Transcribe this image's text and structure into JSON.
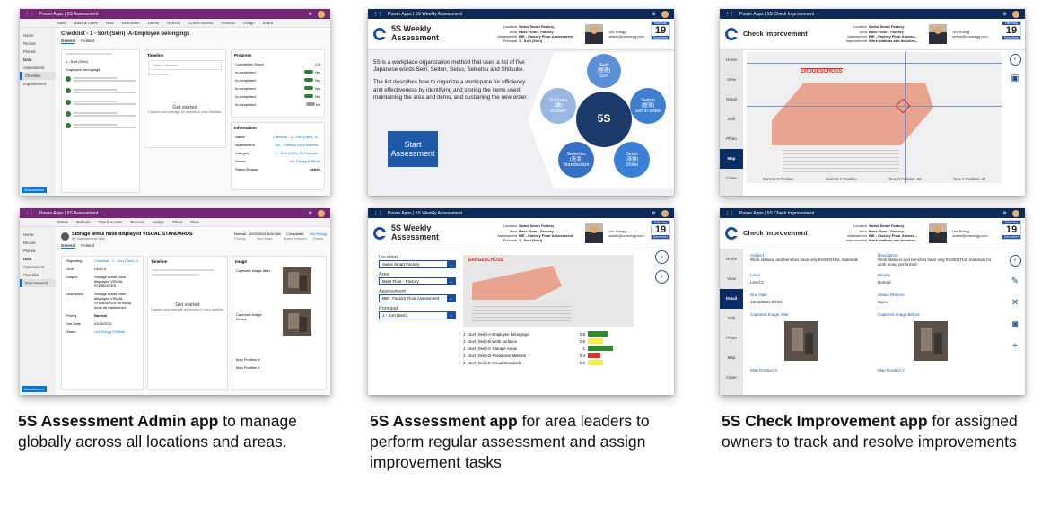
{
  "admin_app": {
    "app_bar": "Power Apps | 5S Assessment",
    "commands": [
      "Save",
      "Save & Close",
      "New",
      "Deactivate",
      "Delete",
      "Refresh",
      "Check Access",
      "Process",
      "Assign",
      "Share",
      "Flow"
    ],
    "nav": {
      "items": [
        "Home",
        "Recent",
        "Pinned"
      ],
      "section": "Data",
      "data_items": [
        "Assessment",
        "Checklist",
        "Improvement"
      ],
      "footer": "Assessment"
    },
    "screen1": {
      "title": "Checklist - 1 - Sort (Seiri) -A-Employee belongings",
      "subtitle": "5S Checklist",
      "tabs": [
        "General",
        "Related"
      ],
      "item_label": "1 - Sort (Seiri)",
      "item_label_2": "Employee belongings",
      "timeline_title": "Timeline",
      "search_placeholder": "Search timeline",
      "note_placeholder": "Enter a note...",
      "get_started": "Get started",
      "get_started_sub": "Capture and manage all records in your timeline.",
      "progress_title": "Progress",
      "progress_rows": [
        {
          "label": "Completion Score",
          "value": "0.8"
        },
        {
          "label": "Is completed",
          "value": "Yes"
        },
        {
          "label": "Is completed",
          "value": "Yes"
        },
        {
          "label": "Is completed",
          "value": "Yes"
        },
        {
          "label": "Is completed",
          "value": "Yes"
        },
        {
          "label": "Is completed",
          "value": "No"
        }
      ],
      "info_title": "Information",
      "info_rows": [
        {
          "label": "Name",
          "value": "Checklist - 1 - Sort (Seiri) -A..."
        },
        {
          "label": "Assessment",
          "value": "BE - Factory Floor Assess..."
        },
        {
          "label": "Category",
          "value": "1 - Sort (Seiri) -A-Employe..."
        },
        {
          "label": "Owner",
          "value": "Urs Rüegg (Offline)"
        },
        {
          "label": "Status Reason",
          "value": "Active"
        }
      ]
    },
    "screen2": {
      "title": "Storage areas have displayed VISUAL STANDARDS",
      "subtitle": "5S Improvement Task",
      "tabs": [
        "General",
        "Related"
      ],
      "summary": [
        {
          "label": "Normal",
          "sub": "Priority"
        },
        {
          "label": "02/20/2021 8:00 AM",
          "sub": "Due Date"
        },
        {
          "label": "Completed",
          "sub": "Status Reason"
        },
        {
          "label": "Urs Rüegg",
          "sub": "Owner"
        }
      ],
      "fields": [
        {
          "label": "Regarding",
          "value": "Checklist - 1 - Sort (Seiri) -C..."
        },
        {
          "label": "Level",
          "value": "Level 4"
        },
        {
          "label": "Subject",
          "value": "Storage areas have displayed VISUAL STANDARDS"
        },
        {
          "label": "Description",
          "value": "Storage areas have displayed VISUAL STANDARDS for setup must be maintained"
        },
        {
          "label": "Priority",
          "value": "Normal"
        },
        {
          "label": "Due Date",
          "value": "02/20/2021"
        },
        {
          "label": "Owner",
          "value": "Urs Rüegg (Offline)"
        }
      ],
      "timeline_title": "Timeline",
      "get_started": "Get started",
      "get_started_sub": "Capture and manage all records in your timeline.",
      "image_title": "Image",
      "image_labels": [
        "Captured Image After",
        "Captured Image Before",
        "Map Position X",
        "Map Position Y"
      ]
    }
  },
  "assessment_app": {
    "app_bar": "Power Apps | 5S Weekly Assessment",
    "title": "5S Weekly Assessment",
    "meta": [
      {
        "label": "Location",
        "value": "Swiss Smart Factory"
      },
      {
        "label": "Area",
        "value": "Base Floor - Factory"
      },
      {
        "label": "Assessment",
        "value": "BIE - Factory Floor Assessment"
      },
      {
        "label": "Principal",
        "value": "1 - Sort (Seiri)"
      }
    ],
    "user_name": "Urs Rüegg",
    "user_email": "admin@ursruegg.com",
    "date": {
      "weekday": "Saturday",
      "day": "19",
      "month": "December"
    },
    "intro_1": "5S is a workplace organization method that uses a list of five Japanese words Seiri, Seiton, Seiso, Seiketsu and Shitsuke.",
    "intro_2": "The list describes how to organize a workspace for efficiency and effectiveness by identifying and storing the items used, maintaining the area and items, and sustaining the new order.",
    "start_button": "Start Assessment",
    "center_label": "5S",
    "petals": [
      {
        "l1": "Seiri",
        "l2": "(整理)",
        "l3": "Sort",
        "color": "#5b8fd6"
      },
      {
        "l1": "Seiton",
        "l2": "(整頓)",
        "l3": "Set in order",
        "color": "#3f7fd0"
      },
      {
        "l1": "Seiso",
        "l2": "(清掃)",
        "l3": "Shine",
        "color": "#3a80d6"
      },
      {
        "l1": "Seiketsu",
        "l2": "(清潔)",
        "l3": "Standardize",
        "color": "#3470c4"
      },
      {
        "l1": "Shitsuke",
        "l2": "(躾)",
        "l3": "Sustain",
        "color": "#9ab6e3"
      }
    ],
    "screen2": {
      "filters": [
        {
          "label": "Location",
          "value": "Swiss Smart Factory"
        },
        {
          "label": "Area",
          "value": "Base Floor - Factory"
        },
        {
          "label": "Assessment",
          "value": "BIE - Factory Floor Assessment"
        },
        {
          "label": "Principal",
          "value": "1 - Sort (Seiri)"
        }
      ],
      "floor_label": "ERDGESCHOSS",
      "results": [
        {
          "name": "1 - Sort (Seiri)-A-Employee belongings",
          "value": "0.8",
          "fill": 0.8,
          "color": "#2e8b2e"
        },
        {
          "name": "1 - Sort (Seiri)-B-Work surfaces",
          "value": "0.6",
          "fill": 0.6,
          "color": "#f3f13b"
        },
        {
          "name": "1 - Sort (Seiri)-C-Storage Areas",
          "value": "1",
          "fill": 1.0,
          "color": "#2e8b2e"
        },
        {
          "name": "1 - Sort (Seiri)-D-Production Material",
          "value": "0.4",
          "fill": 0.5,
          "color": "#e53030"
        },
        {
          "name": "1 - Sort (Seiri)-E-Visual Standards",
          "value": "0.6",
          "fill": 0.6,
          "color": "#f3f13b"
        }
      ]
    }
  },
  "check_app": {
    "app_bar": "Power Apps | 5S Check Improvement",
    "title": "Check Improvement",
    "meta": [
      {
        "label": "Location",
        "value": "Swiss Smart Factory"
      },
      {
        "label": "Area",
        "value": "Base Floor - Factory"
      },
      {
        "label": "Assessment",
        "value": "BIE - Factory Floor Assess..."
      },
      {
        "label": "Improvement",
        "value": "Work stations and benches..."
      }
    ],
    "user_name": "Urs Rüegg",
    "user_email": "admin@ursruegg.com",
    "date": {
      "weekday": "Saturday",
      "day": "19",
      "month": "December"
    },
    "nav": [
      "Home",
      "View",
      "Detail",
      "Edit",
      "Photo",
      "Map",
      "Close"
    ],
    "map_screen": {
      "floor_label": "ERDGESCHOSS",
      "positions": [
        "Current X Position",
        "Current Y Position",
        "New X Position: 62",
        "New Y Position: 62"
      ]
    },
    "detail_screen": {
      "fields": [
        {
          "label": "Subject",
          "value": "Work stations and benches have only ESSENTIAL materials"
        },
        {
          "label": "Description",
          "value": "Work stations and benches have only ESSENTIAL materials for work being performed"
        },
        {
          "label": "Level",
          "value": "Level 2"
        },
        {
          "label": "Priority",
          "value": "Normal"
        },
        {
          "label": "Due Date",
          "value": "19/12/2021 08:00"
        },
        {
          "label": "Status Reason",
          "value": "Open"
        }
      ],
      "image_after": "Captured Image After",
      "image_before": "Captured Image Before",
      "map_x": "Map Position X",
      "map_y": "Map Position Y"
    }
  },
  "captions": [
    {
      "bold": "5S Assessment Admin app",
      "rest": " to manage globally across all locations and areas."
    },
    {
      "bold": "5S Assessment app",
      "rest": " for area leaders to perform regular assessment and assign improvement tasks"
    },
    {
      "bold": "5S Check Improvement app",
      "rest": " for assigned owners to track and resolve improvements"
    }
  ]
}
